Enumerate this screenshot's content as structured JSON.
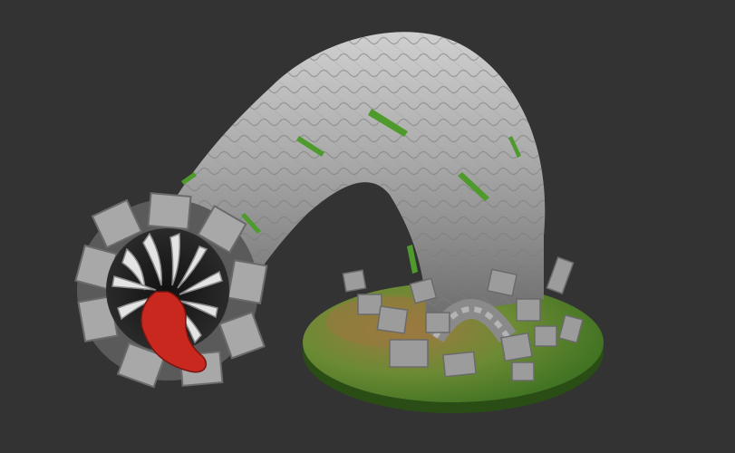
{
  "scene": {
    "background": "#333333",
    "subject": "stone-worm-miniature",
    "colors": {
      "stone": "#9a9a9a",
      "stone_light": "#c9c9c9",
      "stone_dark": "#5e5e5e",
      "moss": "#4f9a2c",
      "tongue": "#c8281e",
      "base_earth": "#8a6a3a",
      "base_grass": "#5aa032"
    }
  }
}
